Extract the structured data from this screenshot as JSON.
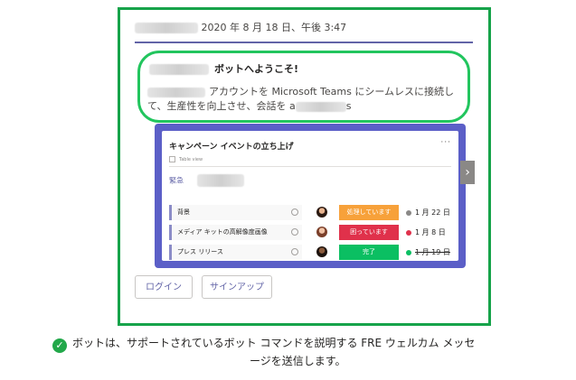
{
  "message": {
    "timestamp": "2020 年 8 月 18 日、午後 3:47",
    "welcome_title": "ボットへようこそ!",
    "welcome_body_part1": "アカウントを Microsoft Teams にシームレスに接続して、生産性を向上させ、会話を a",
    "welcome_body_part2": "s"
  },
  "adaptive_card": {
    "title": "キャンペーン イベントの立ち上げ",
    "more": "···",
    "subtitle": "Table view",
    "urgent_label": "緊急",
    "tasks": [
      {
        "name": "背景",
        "status": "処理しています",
        "status_color": "#f7a13a",
        "date": "1 月 22 日",
        "date_dot_color": "#8a8886",
        "strike": false
      },
      {
        "name": "メディア キットの高解像度画像",
        "status": "困っています",
        "status_color": "#e0314b",
        "date": "1 月 8 日",
        "date_dot_color": "#e0314b",
        "strike": false
      },
      {
        "name": "プレス リリース",
        "status": "完了",
        "status_color": "#0bbf62",
        "date": "1 月 19 日",
        "date_dot_color": "#0bbf62",
        "strike": true
      }
    ],
    "next_arrow": "›"
  },
  "buttons": {
    "login": "ログイン",
    "signup": "サインアップ"
  },
  "caption": {
    "line1": "ボットは、サポートされているボット コマンドを説明する FRE ウェルカム メッセ",
    "line2": "ージを送信します。"
  }
}
